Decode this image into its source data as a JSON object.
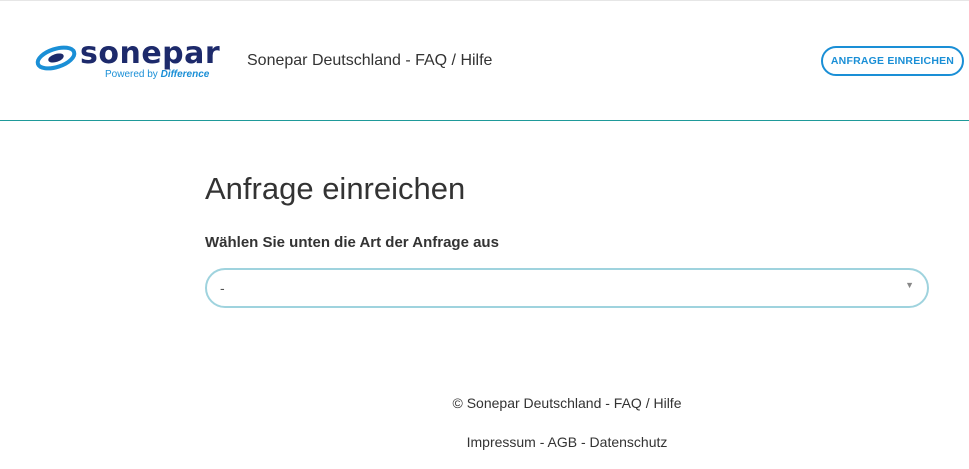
{
  "header": {
    "logo": {
      "wordmark": "sonepar",
      "tagline_prefix": "Powered by",
      "tagline_emphasis": "Difference",
      "icon": "sonepar-swirl-icon",
      "colors": {
        "navy": "#1d2a6b",
        "blue": "#1a8fd6"
      }
    },
    "site_title": "Sonepar Deutschland - FAQ / Hilfe",
    "submit_request_label": "ANFRAGE EINREICHEN"
  },
  "main": {
    "title": "Anfrage einreichen",
    "select_label": "Wählen Sie unten die Art der Anfrage aus",
    "select_value": "-",
    "select_arrow": "▼"
  },
  "footer": {
    "copyright": "© Sonepar Deutschland - FAQ / Hilfe",
    "links": [
      {
        "label": "Impressum"
      },
      {
        "label": "AGB"
      },
      {
        "label": "Datenschutz"
      }
    ],
    "separator": " - "
  },
  "colors": {
    "accent": "#1a8fd6",
    "header_border": "#1f9a9a",
    "select_border": "#9fd3de"
  }
}
